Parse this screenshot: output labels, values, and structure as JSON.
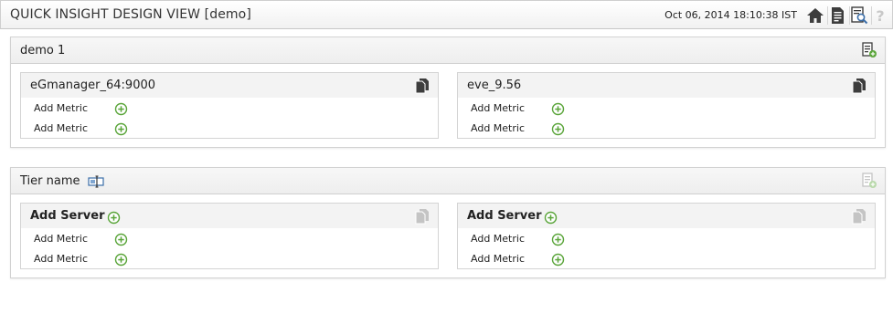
{
  "header": {
    "title": "QUICK INSIGHT DESIGN VIEW [demo]",
    "timestamp": "Oct 06, 2014 18:10:38 IST",
    "icons": [
      "home-icon",
      "report-icon",
      "preview-icon",
      "help-icon"
    ]
  },
  "panels": [
    {
      "title": "demo 1",
      "servers": [
        {
          "name": "eGmanager_64:9000",
          "metrics": [
            "Add Metric",
            "Add Metric"
          ]
        },
        {
          "name": "eve_9.56",
          "metrics": [
            "Add Metric",
            "Add Metric"
          ]
        }
      ]
    },
    {
      "title": "Tier name",
      "servers": [
        {
          "name": "Add Server",
          "metrics": [
            "Add Metric",
            "Add Metric"
          ]
        },
        {
          "name": "Add Server",
          "metrics": [
            "Add Metric",
            "Add Metric"
          ]
        }
      ]
    }
  ],
  "colors": {
    "plus_green": "#5aa53a",
    "icon_dark": "#3d3d3d",
    "icon_disabled": "#bdbdbd",
    "edit_blue": "#3b6ea8"
  }
}
